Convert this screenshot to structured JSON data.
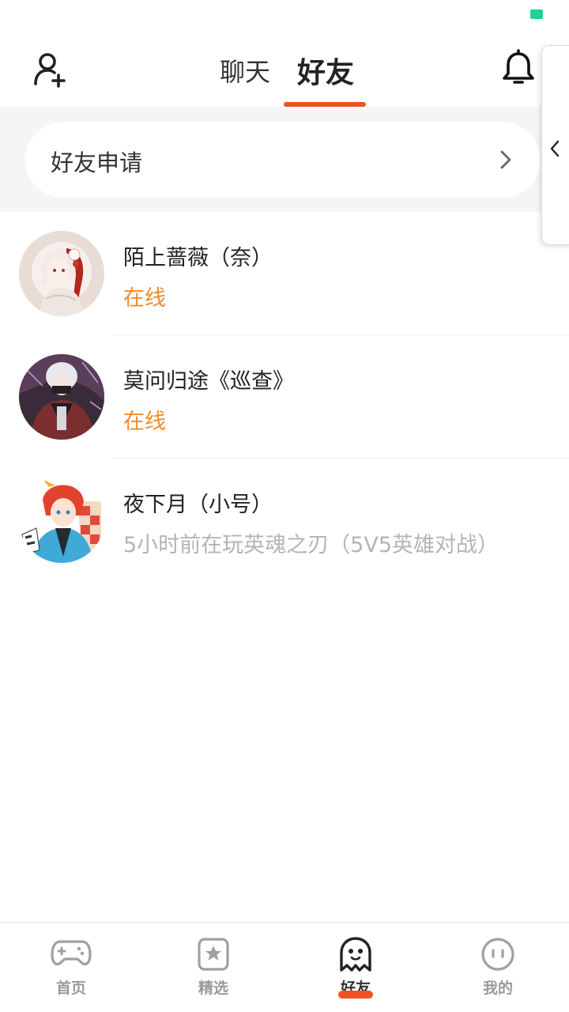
{
  "header": {
    "tabs": [
      {
        "label": "聊天",
        "active": false
      },
      {
        "label": "好友",
        "active": true
      }
    ],
    "add_friend_icon": "add-user-icon",
    "notification_icon": "bell-icon",
    "accent_color": "#f05323"
  },
  "side_handle": {
    "icon": "chevron-left-icon"
  },
  "friend_request": {
    "label": "好友申请",
    "icon": "chevron-right-icon"
  },
  "friends": [
    {
      "name": "陌上蔷薇（奈）",
      "status": "在线",
      "online": true
    },
    {
      "name": "莫问归途《巡查》",
      "status": "在线",
      "online": true
    },
    {
      "name": "夜下月（小号）",
      "status": "5小时前在玩英魂之刃（5V5英雄对战）",
      "online": false
    }
  ],
  "bottom_nav": {
    "items": [
      {
        "label": "首页",
        "icon": "gamepad-icon",
        "active": false
      },
      {
        "label": "精选",
        "icon": "star-bookmark-icon",
        "active": false
      },
      {
        "label": "好友",
        "icon": "ghost-icon",
        "active": true
      },
      {
        "label": "我的",
        "icon": "face-icon",
        "active": false
      }
    ]
  },
  "colors": {
    "online": "#f08a2b",
    "offline": "#b4b4b4",
    "status_indicator": "#1ed48f"
  }
}
